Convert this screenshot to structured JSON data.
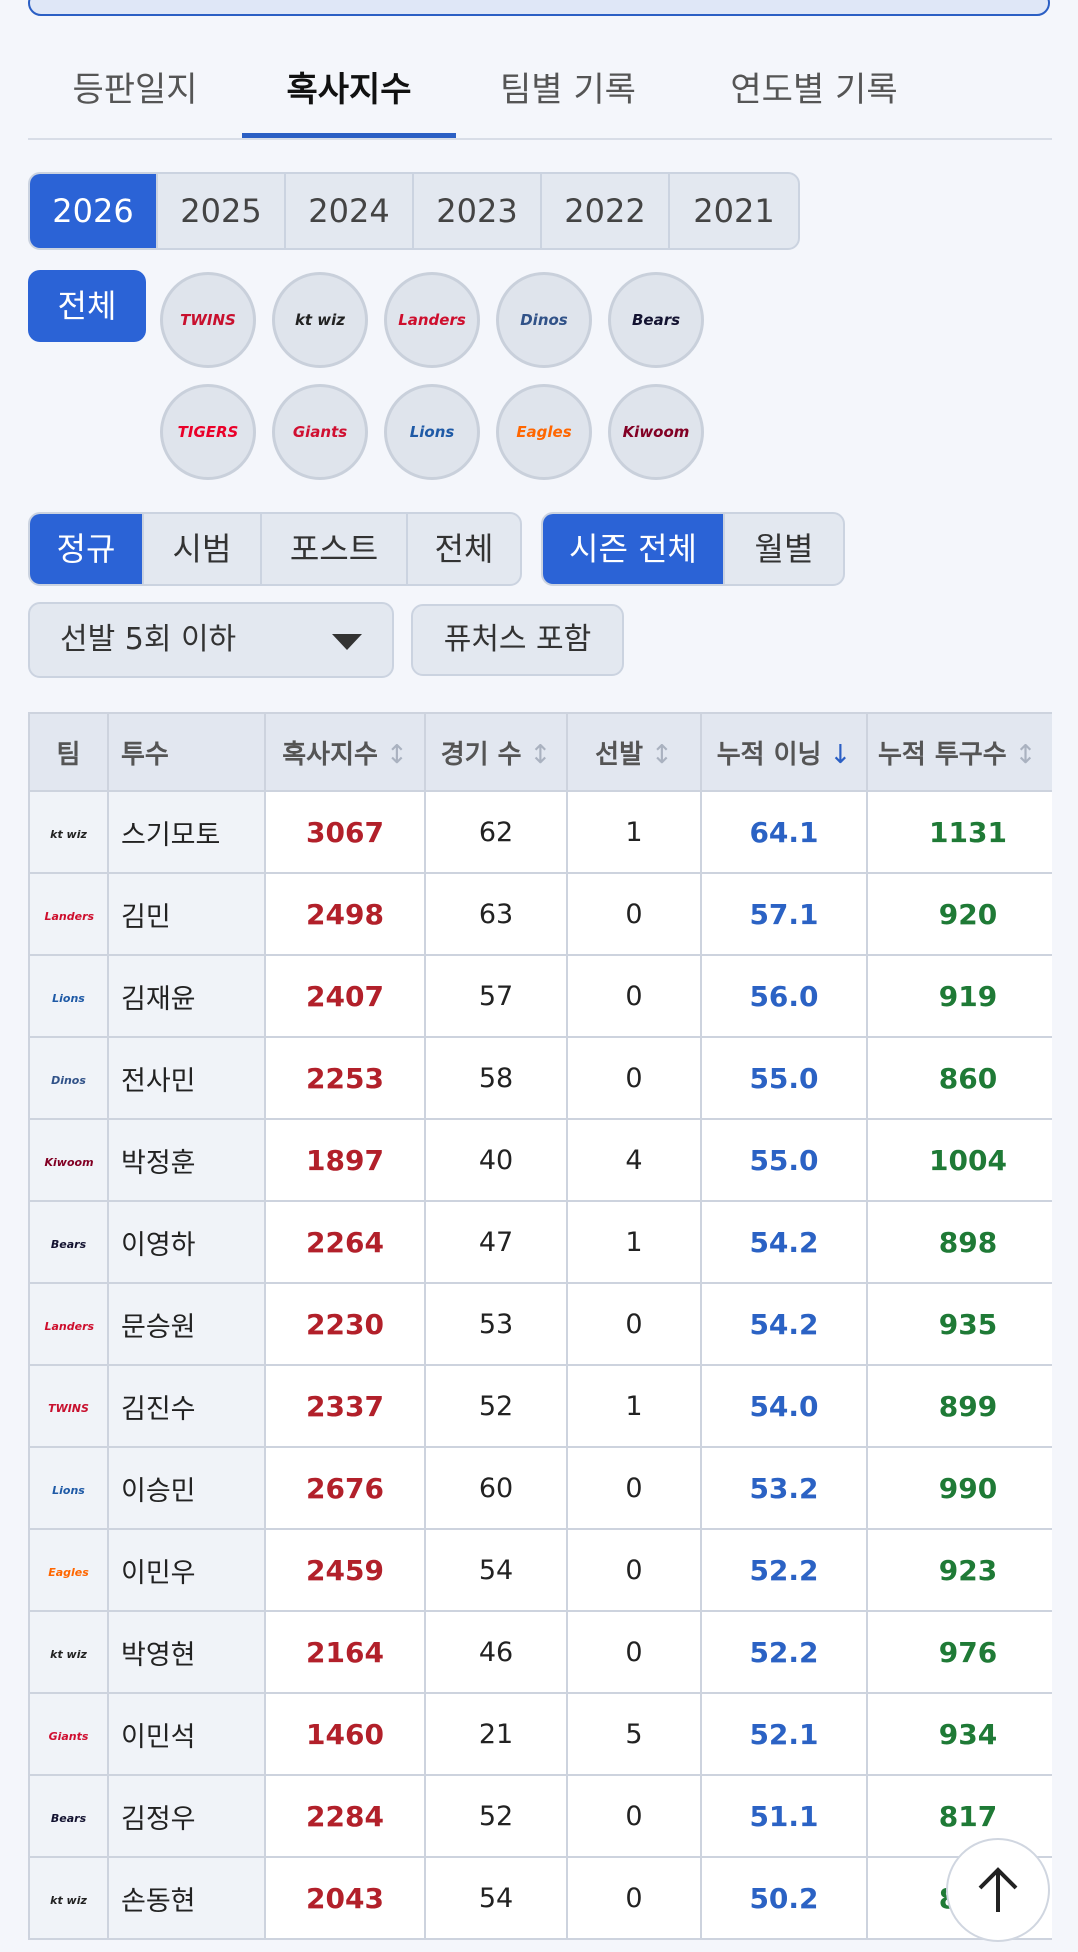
{
  "tabs": [
    {
      "label": "등판일지",
      "active": false
    },
    {
      "label": "혹사지수",
      "active": true
    },
    {
      "label": "팀별 기록",
      "active": false
    },
    {
      "label": "연도별 기록",
      "active": false
    }
  ],
  "years": [
    {
      "label": "2026",
      "active": true
    },
    {
      "label": "2025",
      "active": false
    },
    {
      "label": "2024",
      "active": false
    },
    {
      "label": "2023",
      "active": false
    },
    {
      "label": "2022",
      "active": false
    },
    {
      "label": "2021",
      "active": false
    }
  ],
  "team_filter": {
    "all_label": "전체",
    "teams": [
      {
        "icon": "twins-logo-icon",
        "text": "TWINS",
        "color": "#c8102e"
      },
      {
        "icon": "ktwiz-logo-icon",
        "text": "kt wiz",
        "color": "#222222"
      },
      {
        "icon": "landers-logo-icon",
        "text": "Landers",
        "color": "#ce0e2d"
      },
      {
        "icon": "dinos-logo-icon",
        "text": "Dinos",
        "color": "#315288"
      },
      {
        "icon": "bears-logo-icon",
        "text": "Bears",
        "color": "#131230"
      },
      {
        "icon": "tigers-logo-icon",
        "text": "TIGERS",
        "color": "#ea0029"
      },
      {
        "icon": "giants-logo-icon",
        "text": "Giants",
        "color": "#d00f31"
      },
      {
        "icon": "lions-logo-icon",
        "text": "Lions",
        "color": "#1f5aa6"
      },
      {
        "icon": "eagles-logo-icon",
        "text": "Eagles",
        "color": "#ff6600"
      },
      {
        "icon": "kiwoom-logo-icon",
        "text": "Kiwoom",
        "color": "#820024"
      }
    ]
  },
  "game_type": [
    {
      "label": "정규",
      "active": true
    },
    {
      "label": "시범",
      "active": false
    },
    {
      "label": "포스트",
      "active": false
    },
    {
      "label": "전체",
      "active": false
    }
  ],
  "period": [
    {
      "label": "시즌 전체",
      "active": true
    },
    {
      "label": "월별",
      "active": false
    }
  ],
  "dropdown": {
    "value": "선발 5회 이하"
  },
  "futures_label": "퓨처스 포함",
  "table": {
    "headers": {
      "team": "팀",
      "pitcher": "투수",
      "index": "혹사지수",
      "games": "경기 수",
      "starts": "선발",
      "innings": "누적 이닝",
      "pitches": "누적 투구수"
    },
    "sort_neutral": "↕",
    "sort_down": "↓",
    "rows": [
      {
        "team": "kt wiz",
        "color": "#222222",
        "name": "스기모토",
        "index": "3067",
        "games": "62",
        "starts": "1",
        "innings": "64.1",
        "pitches": "1131"
      },
      {
        "team": "Landers",
        "color": "#ce0e2d",
        "name": "김민",
        "index": "2498",
        "games": "63",
        "starts": "0",
        "innings": "57.1",
        "pitches": "920"
      },
      {
        "team": "Lions",
        "color": "#1f5aa6",
        "name": "김재윤",
        "index": "2407",
        "games": "57",
        "starts": "0",
        "innings": "56.0",
        "pitches": "919"
      },
      {
        "team": "Dinos",
        "color": "#315288",
        "name": "전사민",
        "index": "2253",
        "games": "58",
        "starts": "0",
        "innings": "55.0",
        "pitches": "860"
      },
      {
        "team": "Kiwoom",
        "color": "#820024",
        "name": "박정훈",
        "index": "1897",
        "games": "40",
        "starts": "4",
        "innings": "55.0",
        "pitches": "1004"
      },
      {
        "team": "Bears",
        "color": "#131230",
        "name": "이영하",
        "index": "2264",
        "games": "47",
        "starts": "1",
        "innings": "54.2",
        "pitches": "898"
      },
      {
        "team": "Landers",
        "color": "#ce0e2d",
        "name": "문승원",
        "index": "2230",
        "games": "53",
        "starts": "0",
        "innings": "54.2",
        "pitches": "935"
      },
      {
        "team": "TWINS",
        "color": "#c8102e",
        "name": "김진수",
        "index": "2337",
        "games": "52",
        "starts": "1",
        "innings": "54.0",
        "pitches": "899"
      },
      {
        "team": "Lions",
        "color": "#1f5aa6",
        "name": "이승민",
        "index": "2676",
        "games": "60",
        "starts": "0",
        "innings": "53.2",
        "pitches": "990"
      },
      {
        "team": "Eagles",
        "color": "#ff6600",
        "name": "이민우",
        "index": "2459",
        "games": "54",
        "starts": "0",
        "innings": "52.2",
        "pitches": "923"
      },
      {
        "team": "kt wiz",
        "color": "#222222",
        "name": "박영현",
        "index": "2164",
        "games": "46",
        "starts": "0",
        "innings": "52.2",
        "pitches": "976"
      },
      {
        "team": "Giants",
        "color": "#d00f31",
        "name": "이민석",
        "index": "1460",
        "games": "21",
        "starts": "5",
        "innings": "52.1",
        "pitches": "934"
      },
      {
        "team": "Bears",
        "color": "#131230",
        "name": "김정우",
        "index": "2284",
        "games": "52",
        "starts": "0",
        "innings": "51.1",
        "pitches": "817"
      },
      {
        "team": "kt wiz",
        "color": "#222222",
        "name": "손동현",
        "index": "2043",
        "games": "54",
        "starts": "0",
        "innings": "50.2",
        "pitches": "831"
      }
    ]
  },
  "scroll_top_icon": "arrow-up-icon"
}
